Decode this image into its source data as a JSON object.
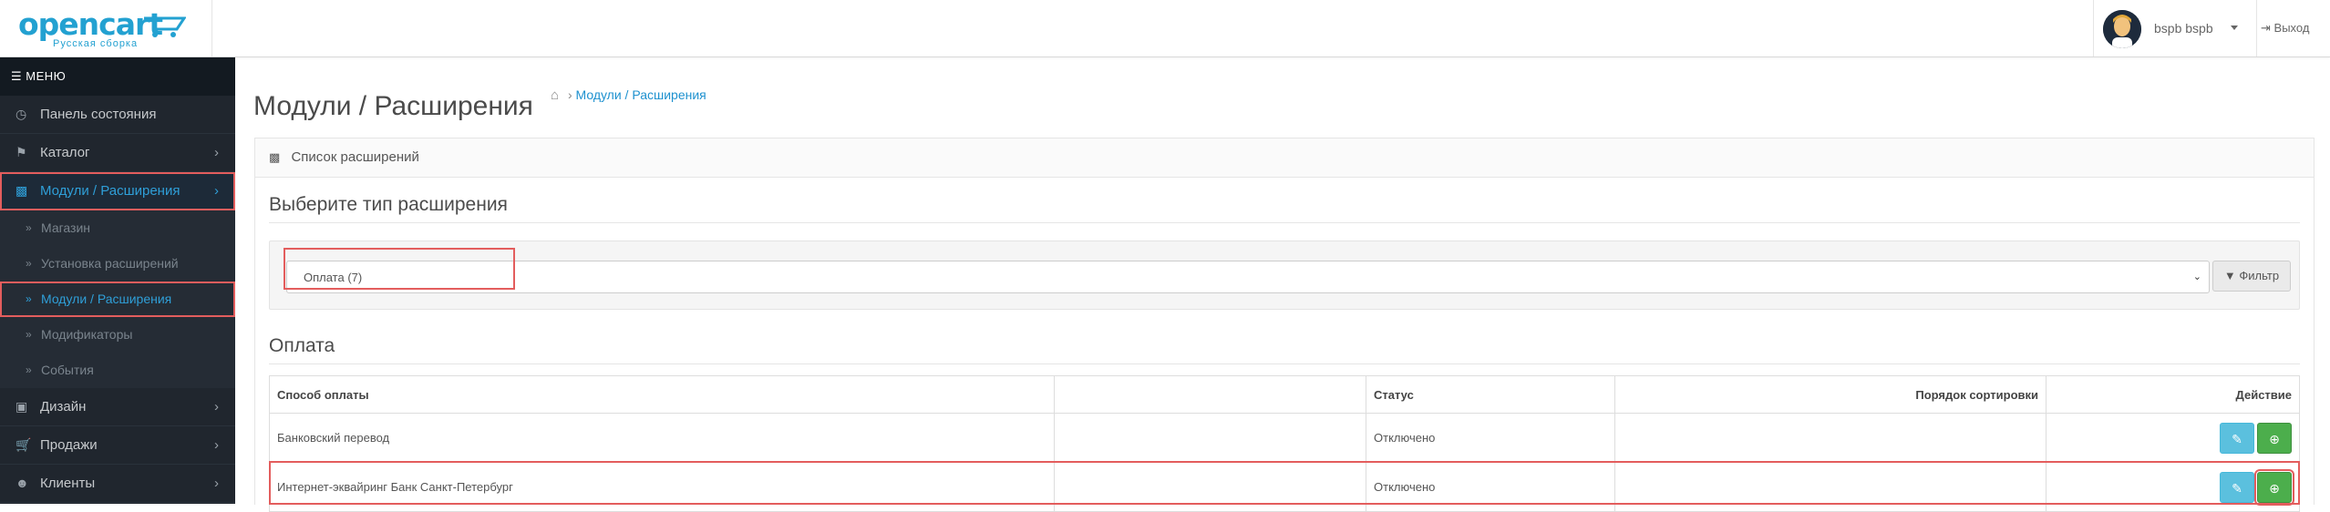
{
  "header": {
    "logo_text": "opencart",
    "logo_sub": "Русская сборка",
    "user_name": "bspb bspb",
    "logout_label": "Выход"
  },
  "sidebar": {
    "menu_label": "МЕНЮ",
    "items": [
      {
        "label": "Панель состояния",
        "icon": "dashboard-icon"
      },
      {
        "label": "Каталог",
        "icon": "tags-icon"
      },
      {
        "label": "Модули / Расширения",
        "icon": "puzzle-icon"
      },
      {
        "label": "Дизайн",
        "icon": "desktop-icon"
      },
      {
        "label": "Продажи",
        "icon": "cart-icon"
      },
      {
        "label": "Клиенты",
        "icon": "user-icon"
      }
    ],
    "sub_items": [
      {
        "label": "Магазин"
      },
      {
        "label": "Установка расширений"
      },
      {
        "label": "Модули / Расширения"
      },
      {
        "label": "Модификаторы"
      },
      {
        "label": "События"
      }
    ]
  },
  "page": {
    "title": "Модули / Расширения",
    "breadcrumb": "Модули / Расширения"
  },
  "panel": {
    "heading": "Список расширений",
    "choose_type": "Выберите тип расширения",
    "select_value": "Оплата (7)",
    "filter_label": "Фильтр",
    "section_title": "Оплата"
  },
  "table": {
    "headers": [
      "Способ оплаты",
      "",
      "Статус",
      "Порядок сортировки",
      "Действие"
    ],
    "rows": [
      {
        "name": "Банковский перевод",
        "extra": "",
        "status": "Отключено",
        "sort": ""
      },
      {
        "name": "Интернет-эквайринг Банк Санкт-Петербург",
        "extra": "",
        "status": "Отключено",
        "sort": ""
      }
    ]
  },
  "colors": {
    "accent": "#1e91cf",
    "sidebar_bg": "#20262e",
    "highlight": "#e35d5d",
    "edit_button": "#5bc0de",
    "install_button": "#4cae4c"
  }
}
